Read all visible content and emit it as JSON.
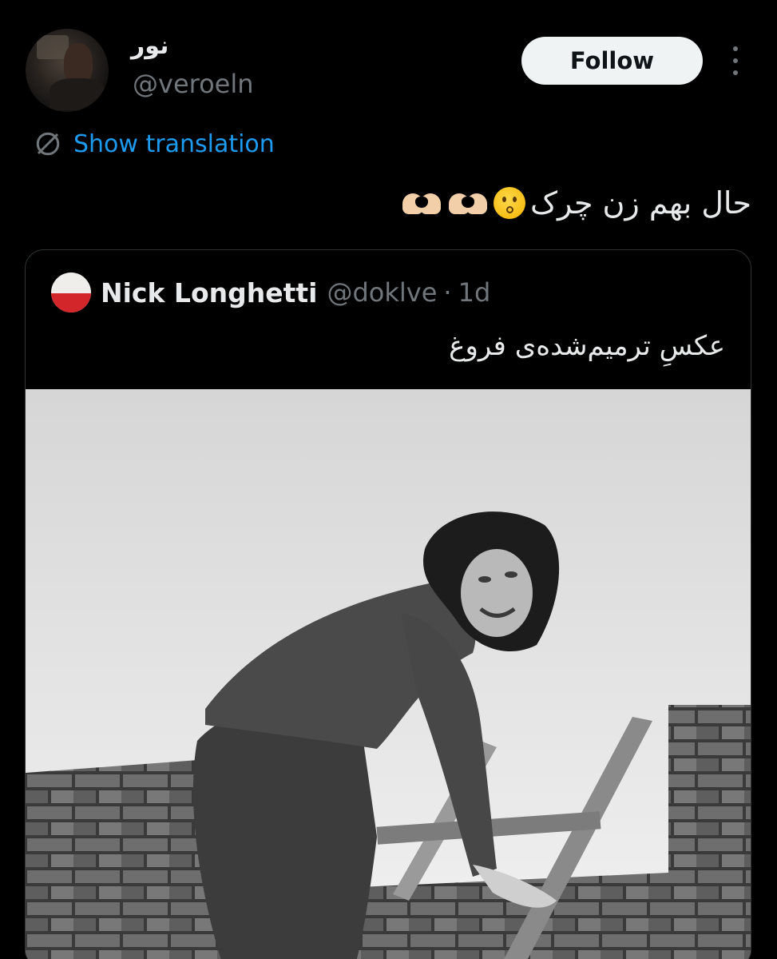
{
  "author": {
    "display_name": "نور",
    "handle": "@veroeln"
  },
  "actions": {
    "follow_label": "Follow",
    "more_icon": "more-vertical-icon"
  },
  "translation": {
    "label": "Show translation",
    "icon": "translate-globe-icon"
  },
  "tweet": {
    "text": "حال بهم زن چرک",
    "emojis": [
      "face-blowing-kiss",
      "heart-hands",
      "heart-hands"
    ]
  },
  "quoted_tweet": {
    "name": "Nick Longhetti",
    "handle": "@doklve",
    "separator": "·",
    "time": "1d",
    "text": "عکسِ ترمیم‌شده‌ی فروغ",
    "avatar_colors": [
      "#f0eeea",
      "#d3262b"
    ]
  },
  "colors": {
    "background": "#000000",
    "link": "#1d9bf0",
    "secondary_text": "#71767b",
    "primary_text": "#e7e9ea",
    "follow_button_bg": "#eff3f4"
  }
}
